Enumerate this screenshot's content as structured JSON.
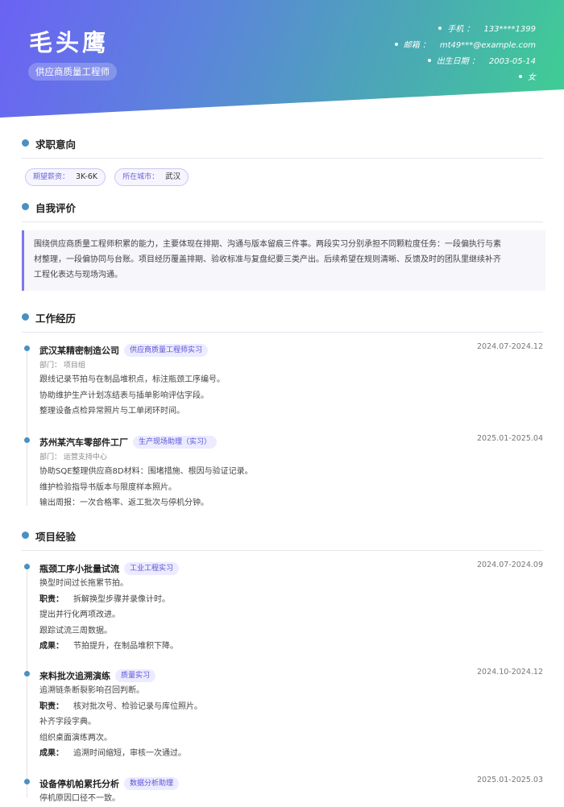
{
  "profile": {
    "name": "毛头鹰",
    "role": "供应商质量工程师"
  },
  "contact": [
    {
      "label": "手机 ：",
      "value": "133****1399"
    },
    {
      "label": "邮箱 ：",
      "value": "mt49***@example.com"
    },
    {
      "label": "出生日期 ：",
      "value": "2003-05-14"
    },
    {
      "label": "",
      "value": "女"
    }
  ],
  "sections": {
    "intent": "求职意向",
    "summary": "自我评价",
    "work": "工作经历",
    "projects": "项目经验"
  },
  "intent": {
    "salary_label": "期望薪资：",
    "salary": "3K-6K",
    "city_label": "所在城市：",
    "city": "武汉"
  },
  "summary": {
    "lines": [
      "围绕供应商质量工程师积累的能力，主要体现在排期、沟通与版本留痕三件事。两段实习分别承担不同颗粒度任务：一段偏执行与素",
      "材整理，一段偏协同与台账。项目经历覆盖排期、验收标准与复盘纪要三类产出。后续希望在规则清晰、反馈及时的团队里继续补齐",
      "工程化表达与现场沟通。"
    ]
  },
  "work": [
    {
      "company": "武汉某精密制造公司",
      "role": "供应商质量工程师实习",
      "date": "2024.07-2024.12",
      "dept": "部门：  项目组",
      "lines": [
        "跟线记录节拍与在制品堆积点，标注瓶颈工序编号。",
        "协助维护生产计划冻结表与插单影响评估字段。",
        "整理设备点检异常照片与工单闭环时间。"
      ]
    },
    {
      "company": "苏州某汽车零部件工厂",
      "role": "生产现场助理（实习）",
      "date": "2025.01-2025.04",
      "dept": "部门：  运营支持中心",
      "lines": [
        "协助SQE整理供应商8D材料：围堵措施、根因与验证记录。",
        "维护检验指导书版本与限度样本照片。",
        "输出周报：一次合格率、返工批次与停机分钟。"
      ]
    }
  ],
  "projects": [
    {
      "name": "瓶颈工序小批量试流",
      "role": "工业工程实习",
      "date": "2024.07-2024.09",
      "desc": "换型时间过长拖累节拍。",
      "duty_label": "职责：",
      "duty": [
        "拆解换型步骤并录像计时。",
        "提出并行化两项改进。",
        "跟踪试流三周数据。"
      ],
      "result_label": "成果：",
      "result": "节拍提升，在制品堆积下降。"
    },
    {
      "name": "来料批次追溯演练",
      "role": "质量实习",
      "date": "2024.10-2024.12",
      "desc": "追溯链条断裂影响召回判断。",
      "duty_label": "职责：",
      "duty": [
        "核对批次号、检验记录与库位照片。",
        "补齐字段字典。",
        "组织桌面演练两次。"
      ],
      "result_label": "成果：",
      "result": "追溯时间缩短，审核一次通过。"
    },
    {
      "name": "设备停机帕累托分析",
      "role": "数据分析助理",
      "date": "2025.01-2025.03",
      "desc": "停机原因口径不一致。"
    }
  ]
}
